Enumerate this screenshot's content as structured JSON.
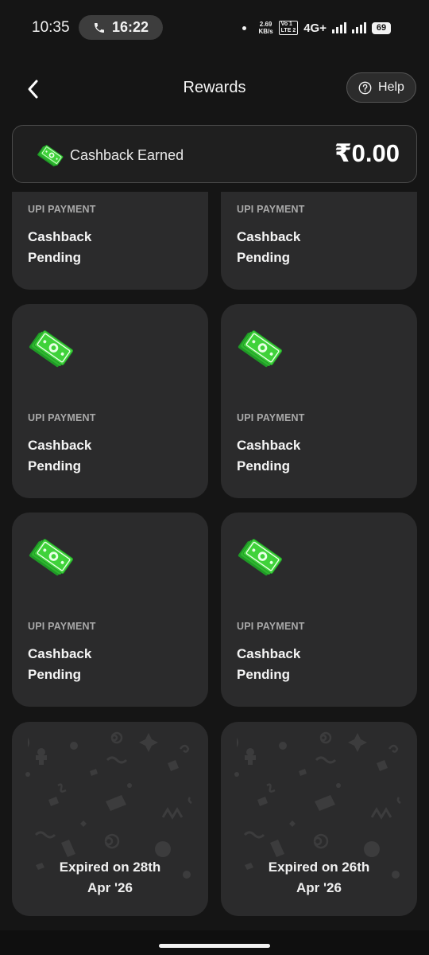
{
  "status_bar": {
    "time": "10:35",
    "call_timer": "16:22",
    "speed_value": "2.69",
    "speed_unit": "KB/s",
    "volte_top": "Vo 1",
    "volte_bottom": "LTE 2",
    "network": "4G+",
    "battery": "69"
  },
  "header": {
    "title": "Rewards",
    "help_label": "Help"
  },
  "cashback": {
    "label": "Cashback Earned",
    "amount": "₹0.00"
  },
  "cards": [
    {
      "type": "UPI PAYMENT",
      "status_line1": "Cashback",
      "status_line2": "Pending"
    },
    {
      "type": "UPI PAYMENT",
      "status_line1": "Cashback",
      "status_line2": "Pending"
    },
    {
      "type": "UPI PAYMENT",
      "status_line1": "Cashback",
      "status_line2": "Pending"
    },
    {
      "type": "UPI PAYMENT",
      "status_line1": "Cashback",
      "status_line2": "Pending"
    },
    {
      "type": "UPI PAYMENT",
      "status_line1": "Cashback",
      "status_line2": "Pending"
    },
    {
      "type": "UPI PAYMENT",
      "status_line1": "Cashback",
      "status_line2": "Pending"
    }
  ],
  "expired_cards": [
    {
      "line1": "Expired on 28th",
      "line2": "Apr '26"
    },
    {
      "line1": "Expired on 26th",
      "line2": "Apr '26"
    }
  ],
  "colors": {
    "background": "#151515",
    "card": "#2b2b2c",
    "money_green": "#3fd23a",
    "money_dark": "#1f9a26"
  },
  "icons": {
    "back": "chevron-left-icon",
    "help": "question-circle-icon",
    "cashback": "money-stack-icon",
    "call": "phone-icon"
  }
}
